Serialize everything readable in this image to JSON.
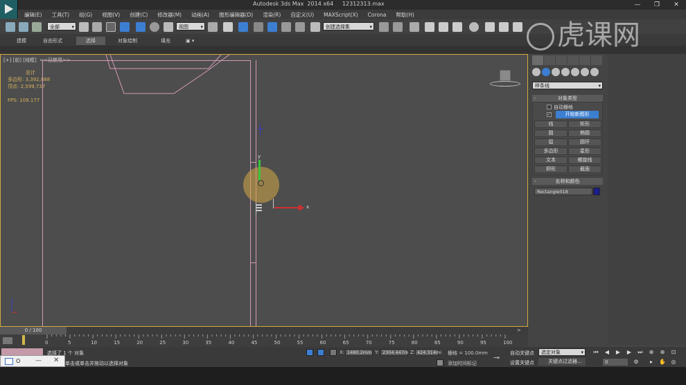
{
  "titlebar": {
    "title": "Autodesk 3ds Max  2014 x64     12312313.max",
    "min": "—",
    "max": "❐",
    "close": "✕"
  },
  "menu": [
    "编辑(E)",
    "工具(T)",
    "组(G)",
    "视图(V)",
    "创建(C)",
    "修改器(M)",
    "动画(A)",
    "图形编辑器(D)",
    "渲染(R)",
    "自定义(U)",
    "MAXScript(X)",
    "Corona",
    "帮助(H)"
  ],
  "toolbar": {
    "selection_filter": "全部",
    "ref_coord": "视图",
    "named_selection": "创建选择集"
  },
  "ribbon": {
    "tabs": [
      "建模",
      "自由形式",
      "选择",
      "对象绘制",
      "填充"
    ],
    "active": "选择"
  },
  "viewport": {
    "label": "[+] [前] [线框]  <<已禁用>>",
    "stats_total_label": "总计",
    "stats_polys": "多边形: 3,392,888",
    "stats_verts": "顶点:  2,599,737",
    "fps": "FPS:    109.177",
    "gizmo_y": "y",
    "gizmo_x": "x"
  },
  "keys_overlay": [
    "左键",
    "左键"
  ],
  "watermark": "虎课网",
  "command_panel": {
    "category": "样条线",
    "object_type_title": "对象类型",
    "auto_grid": "自动栅格",
    "start_new_shape": "开始新图形",
    "buttons": [
      "线",
      "矩形",
      "圆",
      "椭圆",
      "弧",
      "圆环",
      "多边形",
      "星形",
      "文本",
      "螺旋线",
      "卵形",
      "截面"
    ],
    "name_color_title": "名称和颜色",
    "object_name": "Rectangle018",
    "object_color": "#1c1c8c"
  },
  "timeline": {
    "position": "0 / 100",
    "ticks": [
      "0",
      "5",
      "10",
      "15",
      "20",
      "25",
      "30",
      "35",
      "40",
      "45",
      "50",
      "55",
      "60",
      "65",
      "70",
      "75",
      "80",
      "85",
      "90",
      "95",
      "100"
    ]
  },
  "status": {
    "selected": "选择了 1 个 对象",
    "prompt": "单击或单击并拖动以选择对象",
    "x_label": "X:",
    "x_value": "1480.2mm",
    "y_label": "Y:",
    "y_value": "2304.447m",
    "z_label": "Z:",
    "z_value": "424.314mi",
    "grid": "栅格 = 100.0mm",
    "add_time_tag": "添加时间标记"
  },
  "anim": {
    "auto_key": "自动关键点",
    "set_key": "设置关键点",
    "selection": "选定对象",
    "key_filters": "关键点过滤器...",
    "frame": "0"
  },
  "popup": {
    "label": "O"
  }
}
